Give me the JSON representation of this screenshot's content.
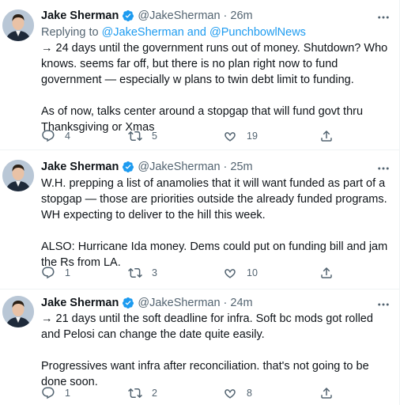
{
  "tweets": [
    {
      "name": "Jake Sherman",
      "handle": "@JakeSherman",
      "dot": "·",
      "time": "26m",
      "reply_prefix": "Replying to ",
      "reply_targets": "@JakeSherman and @PunchbowlNews",
      "paragraphs": [
        "→ 24 days until the government runs out of money. Shutdown? Who knows. seems far off, but there is no plan right now to fund government — especially w plans to twin debt limit to funding.",
        "As of now, talks center around a stopgap that will fund govt thru Thanksgiving or Xmas"
      ],
      "replies": "4",
      "retweets": "5",
      "likes": "19"
    },
    {
      "name": "Jake Sherman",
      "handle": "@JakeSherman",
      "dot": "·",
      "time": "25m",
      "paragraphs": [
        "W.H. prepping a list of anamolies that it will want funded as part of a stopgap — those are priorities outside the already funded programs. WH expecting to deliver to the hill this week.",
        "ALSO: Hurricane Ida money. Dems could put on funding bill and jam the Rs from LA."
      ],
      "replies": "1",
      "retweets": "3",
      "likes": "10"
    },
    {
      "name": "Jake Sherman",
      "handle": "@JakeSherman",
      "dot": "·",
      "time": "24m",
      "paragraphs": [
        "→ 21 days until the soft deadline for infra. Soft bc mods got rolled and Pelosi can change the date quite easily.",
        "Progressives want infra after reconciliation. that's not going to be done soon."
      ],
      "replies": "1",
      "retweets": "2",
      "likes": "8"
    }
  ],
  "icons": {
    "verified": "verified-badge-icon",
    "more": "more-options-icon",
    "reply": "reply-icon",
    "retweet": "retweet-icon",
    "like": "heart-icon",
    "share": "share-icon"
  },
  "colors": {
    "text": "#0f1419",
    "secondary": "#536471",
    "accent": "#1d9bf0",
    "divider": "#eff3f4"
  }
}
